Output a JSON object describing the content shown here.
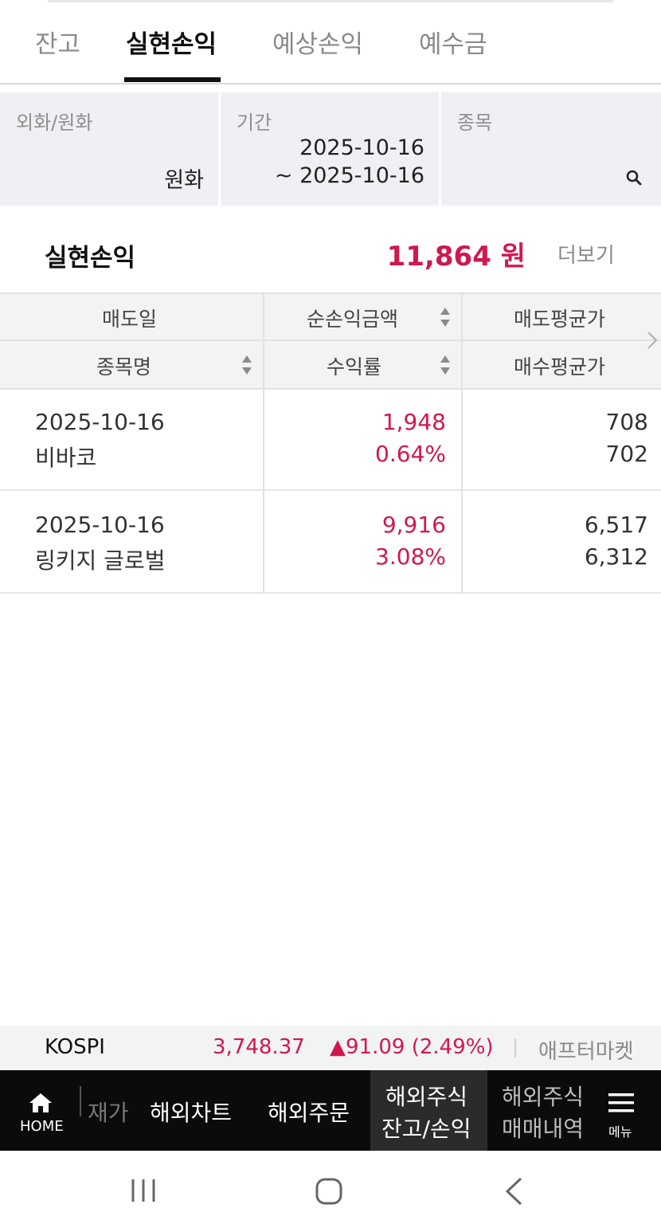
{
  "tabs": [
    {
      "label": "잔고"
    },
    {
      "label": "실현손익"
    },
    {
      "label": "예상손익"
    },
    {
      "label": "예수금"
    }
  ],
  "filters": {
    "currency": {
      "label": "외화/원화",
      "value": "원화"
    },
    "period": {
      "label": "기간",
      "from": "2025-10-16",
      "to": "~ 2025-10-16"
    },
    "stock": {
      "label": "종목",
      "icon": "search-icon"
    }
  },
  "summary": {
    "title": "실현손익",
    "amount": "11,864 원",
    "more_label": "더보기"
  },
  "table": {
    "headers_row1": [
      "매도일",
      "순손익금액",
      "매도평균가"
    ],
    "headers_row2": [
      "종목명",
      "수익률",
      "매수평균가"
    ],
    "rows": [
      {
        "date": "2025-10-16",
        "name": "비바코",
        "profit": "1,948",
        "rate": "0.64%",
        "sell_avg": "708",
        "buy_avg": "702"
      },
      {
        "date": "2025-10-16",
        "name": "링키지 글로벌",
        "profit": "9,916",
        "rate": "3.08%",
        "sell_avg": "6,517",
        "buy_avg": "6,312"
      }
    ]
  },
  "ticker": {
    "name": "KOSPI",
    "value": "3,748.37",
    "change": "▲91.09 (2.49%)",
    "aftermarket": "애프터마켓"
  },
  "bottom_nav": {
    "home": "HOME",
    "items": [
      "재가",
      "해외차트",
      "해외주문"
    ],
    "active_line1": "해외주식",
    "active_line2": "잔고/손익",
    "next_line1": "해외주식",
    "next_line2": "매매내역",
    "menu": "메뉴"
  },
  "colors": {
    "accent_red": "#d0184f",
    "nav_bg": "#0b0b0b",
    "header_bg": "#f2f3f5"
  }
}
